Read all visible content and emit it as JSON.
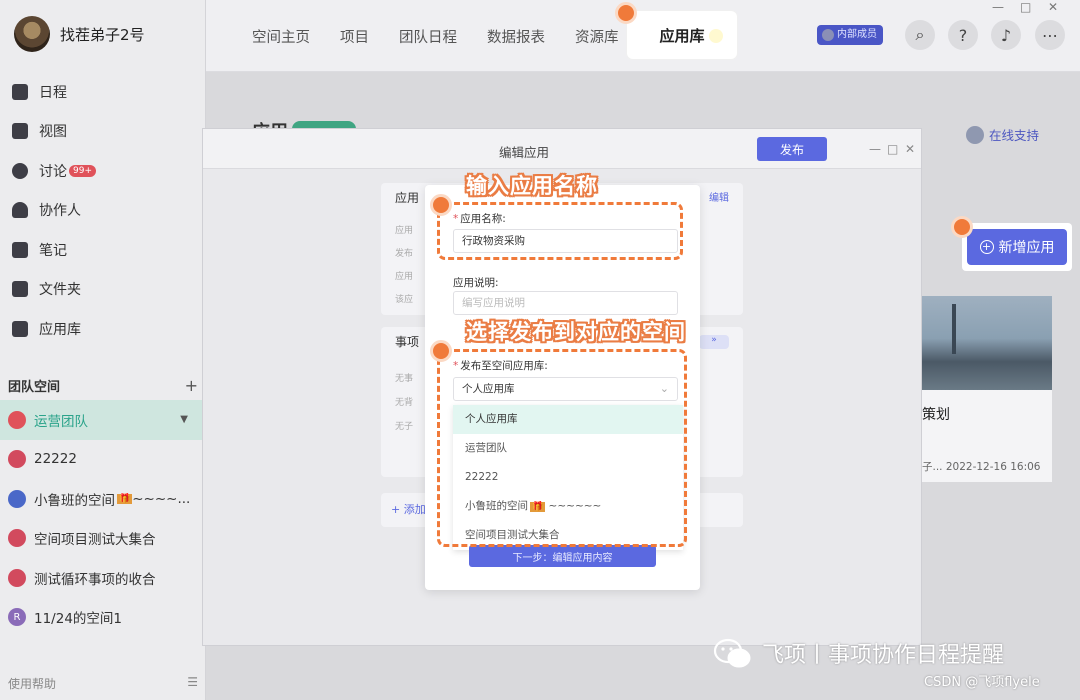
{
  "user": {
    "name": "找茬弟子2号"
  },
  "nav": [
    {
      "label": "日程",
      "icon": "calendar-icon"
    },
    {
      "label": "视图",
      "icon": "chart-icon"
    },
    {
      "label": "讨论",
      "icon": "chat-icon",
      "badge": "99+"
    },
    {
      "label": "协作人",
      "icon": "people-icon"
    },
    {
      "label": "笔记",
      "icon": "notebook-icon"
    },
    {
      "label": "文件夹",
      "icon": "folder-icon"
    },
    {
      "label": "应用库",
      "icon": "app-grid-icon"
    }
  ],
  "team": {
    "heading": "团队空间",
    "add": "+",
    "spaces": [
      {
        "label": "运营团队",
        "color": "#e0525a",
        "active": true
      },
      {
        "label": "22222",
        "color": "#d24a5e"
      },
      {
        "label": "小鲁班的空间",
        "tag": "🎁",
        "suffix": " ~~~~...",
        "color": "#4a68c8"
      },
      {
        "label": "空间项目测试大集合",
        "color": "#d24a5e"
      },
      {
        "label": "测试循环事项的收合",
        "color": "#d24a5e"
      },
      {
        "label": "11/24的空间1",
        "color": "#8a6bb8",
        "letter": "R"
      }
    ]
  },
  "help": {
    "label": "使用帮助"
  },
  "topbar": {
    "tabs": [
      "空间主页",
      "项目",
      "团队日程",
      "数据报表",
      "资源库"
    ],
    "active_tab": "应用库",
    "member_badge": "内部成员",
    "icons": [
      "search-icon",
      "help-icon",
      "bell-icon",
      "more-icon"
    ]
  },
  "background": {
    "title": "应用",
    "support": "在线支持",
    "new_app": "新增应用",
    "card_title": "策划",
    "card_meta": "子... 2022-12-16 16:06"
  },
  "modal": {
    "title": "编辑应用",
    "publish": "发布",
    "panel_edit": "编辑",
    "panel_pill": "»",
    "add_label": "+ 添加"
  },
  "form": {
    "name_label": "应用名称:",
    "name_value": "行政物资采购",
    "desc_label": "应用说明:",
    "desc_placeholder": "编写应用说明",
    "publish_label": "发布至空间应用库:",
    "publish_value": "个人应用库",
    "options": [
      "个人应用库",
      "运营团队",
      "22222",
      "小鲁班的空间",
      "空间项目测试大集合"
    ],
    "option_tag": "🎁",
    "option_suffix": " ~~~~~~",
    "next_button": "下一步：编辑应用内容"
  },
  "annotations": {
    "callout1": "输入应用名称",
    "callout2": "选择发布到对应的空间"
  },
  "watermark": {
    "text": "飞项丨事项协作日程提醒",
    "csdn": "CSDN @飞项flyele"
  }
}
